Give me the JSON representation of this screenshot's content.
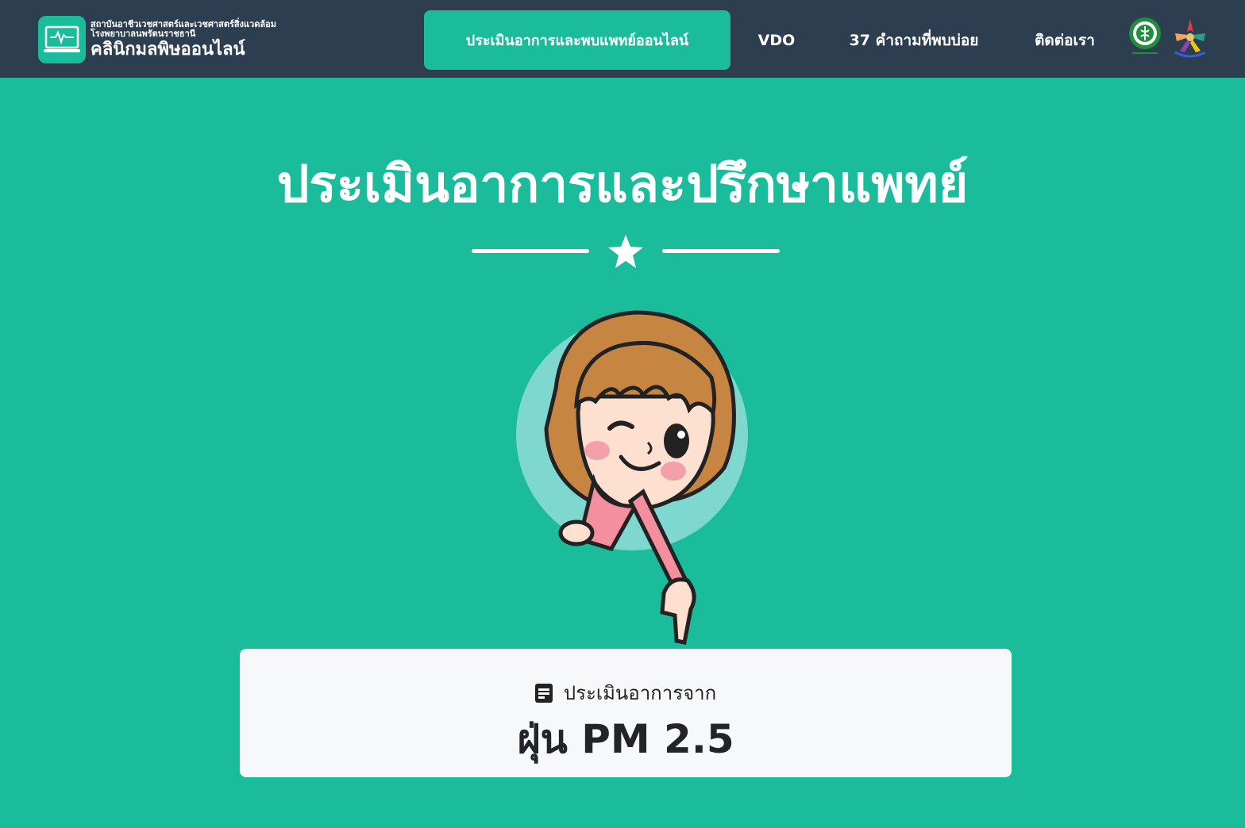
{
  "colors": {
    "navbar": "#2c3e50",
    "accent": "#1abc9c",
    "card": "#f7f8f9",
    "text_dark": "#212529",
    "white": "#ffffff"
  },
  "brand": {
    "icon": "monitor-heartbeat-icon",
    "line1": "สถาบันอาชีวเวชศาสตร์และเวชศาสตร์สิ่งแวดล้อม",
    "line2": "โรงพยาบาลนพรัตนราชธานี",
    "name": "คลินิกมลพิษออนไลน์"
  },
  "nav": {
    "items": [
      {
        "label": "ประเมินอาการและพบแพทย์ออนไลน์",
        "active": true
      },
      {
        "label": "VDO",
        "active": false
      },
      {
        "label": "37 คำถามที่พบบ่อย",
        "active": false
      },
      {
        "label": "ติดต่อเรา",
        "active": false
      }
    ],
    "logos": [
      "ministry-of-public-health-logo",
      "nopparat-hospital-logo"
    ]
  },
  "hero": {
    "title": "ประเมินอาการและปรึกษาแพทย์",
    "divider_icon": "star-icon",
    "illustration": "cartoon-girl-pointing-down"
  },
  "card": {
    "icon": "document-icon",
    "subtitle": "ประเมินอาการจาก",
    "title": "ฝุ่น PM 2.5"
  }
}
